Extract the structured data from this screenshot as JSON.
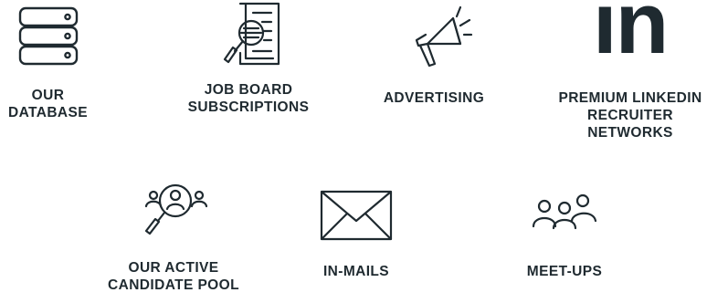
{
  "items": [
    {
      "label": "OUR\nDATABASE",
      "icon": "database-icon"
    },
    {
      "label": "JOB BOARD\nSUBSCRIPTIONS",
      "icon": "document-search-icon"
    },
    {
      "label": "ADVERTISING",
      "icon": "megaphone-icon"
    },
    {
      "label": "PREMIUM LINKEDIN\nRECRUITER\nNETWORKS",
      "icon": "linkedin-icon"
    },
    {
      "label": "OUR ACTIVE\nCANDIDATE POOL",
      "icon": "people-search-icon"
    },
    {
      "label": "IN-MAILS",
      "icon": "envelope-icon"
    },
    {
      "label": "MEET-UPS",
      "icon": "group-icon"
    }
  ],
  "linkedin_logo_text": "in",
  "colors": {
    "icon_stroke": "#1f2a30",
    "text": "#1f2a30",
    "background": "#ffffff"
  }
}
